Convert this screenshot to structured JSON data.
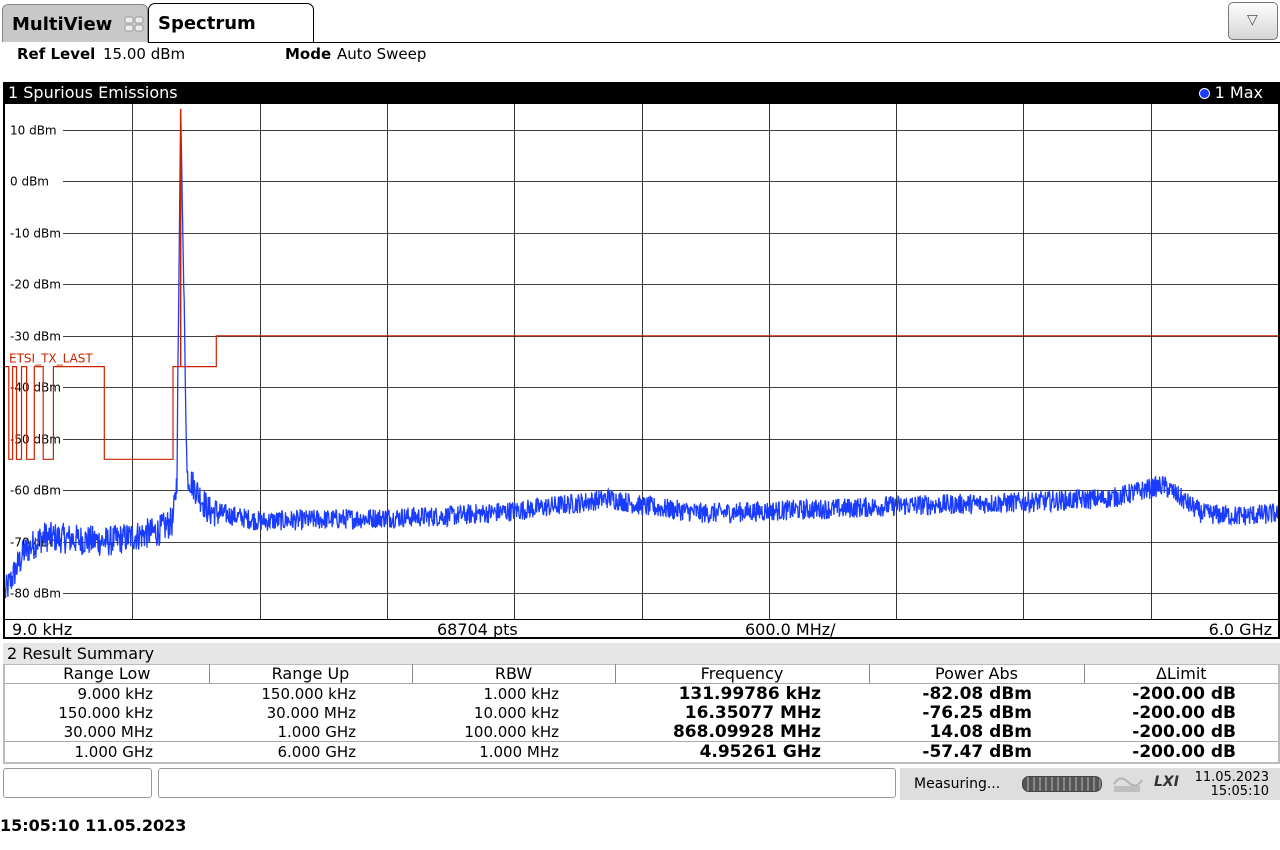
{
  "tabs": [
    {
      "label": "MultiView"
    },
    {
      "label": "Spectrum"
    }
  ],
  "menu_icon": "triangle-down-icon",
  "settings": {
    "ref_level_label": "Ref Level",
    "ref_level_value": "15.00 dBm",
    "mode_label": "Mode",
    "mode_value": "Auto Sweep"
  },
  "diagram": {
    "title": "1 Spurious Emissions",
    "trace_label": "1 Max",
    "trace_color": "#1a3cff",
    "limit_color": "#cc2200",
    "limit_line_name": "ETSI_TX_LAST",
    "footer": {
      "start": "9.0 kHz",
      "points": "68704 pts",
      "span": "600.0 MHz/",
      "stop": "6.0 GHz"
    }
  },
  "chart_data": {
    "type": "line",
    "ylim": [
      -85,
      15
    ],
    "y_ticks": [
      "10 dBm",
      "0 dBm",
      "-10 dBm",
      "-20 dBm",
      "-30 dBm",
      "-40 dBm",
      "-50 dBm",
      "-60 dBm",
      "-70 dBm",
      "-80 dBm"
    ],
    "y_tick_values": [
      10,
      0,
      -10,
      -20,
      -30,
      -40,
      -50,
      -60,
      -70,
      -80
    ],
    "grid": true,
    "series": [
      {
        "name": "1 Max",
        "x": [
          0,
          1.5,
          3,
          8,
          12,
          13.2,
          13.5,
          13.8,
          14.3,
          16,
          20,
          27.5,
          35,
          40,
          45,
          47.5,
          50,
          55,
          60,
          66,
          70,
          78,
          83,
          87,
          91,
          94,
          97,
          100
        ],
        "values": [
          -80,
          -72,
          -69,
          -70,
          -68,
          -66,
          -58,
          14.08,
          -57,
          -64,
          -66,
          -65.5,
          -65,
          -64,
          -62.5,
          -61.5,
          -63,
          -64.5,
          -64,
          -63.5,
          -63,
          -62.5,
          -62,
          -61.5,
          -59,
          -64.5,
          -65,
          -64.5
        ]
      },
      {
        "name": "ETSI_TX_LAST",
        "x": [
          0,
          0.3,
          0.3,
          0.6,
          0.6,
          0.9,
          0.9,
          1.3,
          1.3,
          1.7,
          1.7,
          2.3,
          2.3,
          3.0,
          3.0,
          3.8,
          3.8,
          7.8,
          7.8,
          13.2,
          13.2,
          16.6,
          16.6,
          100
        ],
        "values": [
          -36,
          -36,
          -54,
          -54,
          -36,
          -36,
          -54,
          -54,
          -36,
          -36,
          -54,
          -54,
          -36,
          -36,
          -54,
          -54,
          -36,
          -36,
          -54,
          -54,
          -36,
          -36,
          -30,
          -30
        ]
      }
    ],
    "x_start": "9.0 kHz",
    "x_stop": "6.0 GHz"
  },
  "result_summary": {
    "title": "2 Result Summary",
    "columns": [
      "Range Low",
      "Range Up",
      "RBW",
      "Frequency",
      "Power Abs",
      "ΔLimit"
    ],
    "rows": [
      [
        "9.000 kHz",
        "150.000 kHz",
        "1.000 kHz",
        "131.99786 kHz",
        "-82.08 dBm",
        "-200.00 dB"
      ],
      [
        "150.000 kHz",
        "30.000 MHz",
        "10.000 kHz",
        "16.35077 MHz",
        "-76.25 dBm",
        "-200.00 dB"
      ],
      [
        "30.000 MHz",
        "1.000 GHz",
        "100.000 kHz",
        "868.09928 MHz",
        "14.08 dBm",
        "-200.00 dB"
      ],
      [
        "1.000 GHz",
        "6.000 GHz",
        "1.000 MHz",
        "4.95261 GHz",
        "-57.47 dBm",
        "-200.00 dB"
      ]
    ]
  },
  "status": {
    "measuring": "Measuring...",
    "lxi": "LXI",
    "date": "11.05.2023",
    "time": "15:05:10"
  },
  "footer_stamp": "15:05:10  11.05.2023"
}
